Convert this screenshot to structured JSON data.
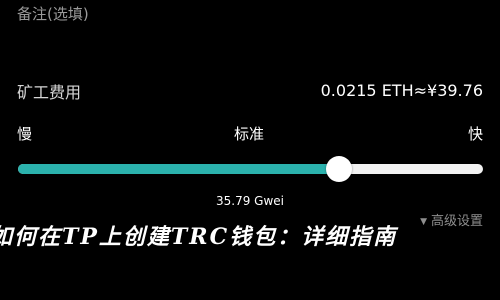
{
  "note": {
    "label": "备注(选填)"
  },
  "fee": {
    "label": "矿工费用",
    "value": "0.0215 ETH≈¥39.76"
  },
  "speed": {
    "slow": "慢",
    "standard": "标准",
    "fast": "快",
    "level_fraction": 0.69,
    "gwei_text": "35.79 Gwei"
  },
  "advanced": {
    "label": "高级设置",
    "icon": "triangle-down-icon"
  },
  "banner": {
    "text": "如何在TP上创建TRC钱包：详细指南"
  },
  "colors": {
    "background": "#000000",
    "slider_fill": "#2bb2ad",
    "slider_track": "#f2f2f2"
  }
}
